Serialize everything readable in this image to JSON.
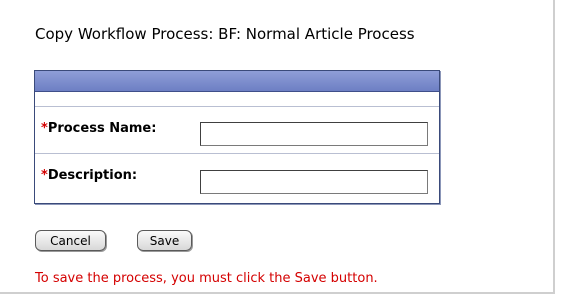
{
  "page": {
    "title": "Copy Workflow Process: BF: Normal Article Process"
  },
  "form": {
    "required_marker": "*",
    "fields": [
      {
        "label": "Process Name:",
        "value": "",
        "placeholder": ""
      },
      {
        "label": "Description:",
        "value": "",
        "placeholder": ""
      }
    ]
  },
  "actions": {
    "cancel_label": "Cancel",
    "save_label": "Save"
  },
  "notice": "To save the process, you must click the Save button.",
  "colors": {
    "required": "#d40000",
    "notice": "#d40000",
    "panel_header": "#7b8bca",
    "panel_border": "#3a4a7a"
  }
}
